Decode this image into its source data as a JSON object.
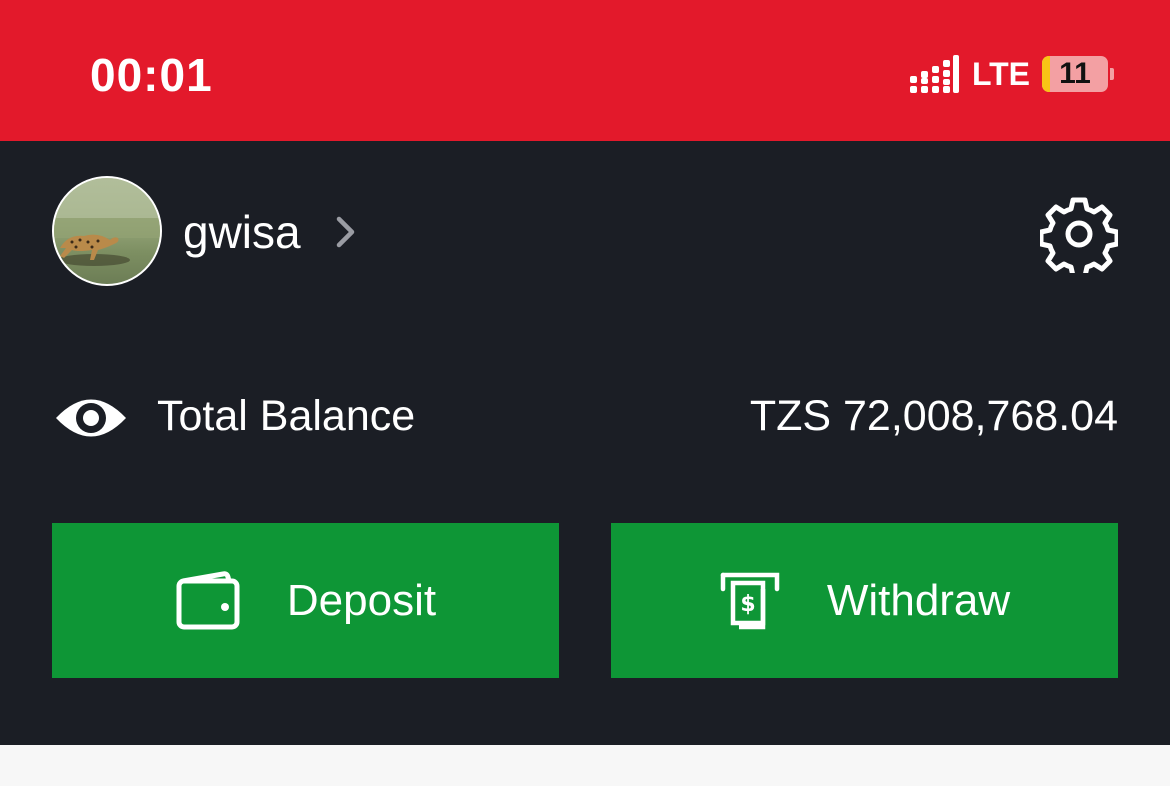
{
  "status_bar": {
    "time": "00:01",
    "network": "LTE",
    "battery_level": "11",
    "colors": {
      "background": "#e3192b",
      "battery": "#f3a0a3",
      "battery_warning": "#f8c316"
    },
    "icons": [
      "signal-icon",
      "battery-icon"
    ]
  },
  "account": {
    "username": "gwisa",
    "icons": [
      "avatar",
      "chevron-right-icon",
      "gear-icon"
    ]
  },
  "balance": {
    "label": "Total Balance",
    "value": "TZS 72,008,768.04",
    "icons": [
      "eye-icon"
    ]
  },
  "actions": {
    "deposit_label": "Deposit",
    "withdraw_label": "Withdraw",
    "icons": [
      "wallet-icon",
      "cash-withdraw-icon"
    ]
  },
  "colors": {
    "panel_background": "#1b1e25",
    "action_green": "#0e9636",
    "page_background": "#f7f7f7"
  }
}
